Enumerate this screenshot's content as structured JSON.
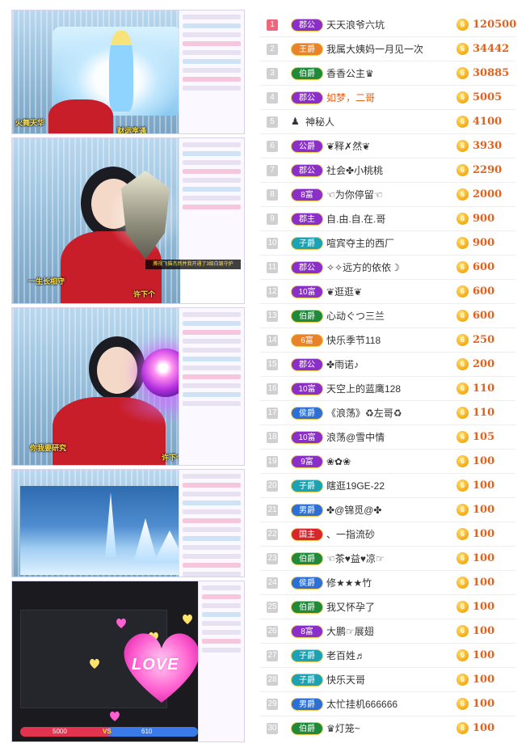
{
  "colors": {
    "rank_top": "#f0657a",
    "rank_default": "#d0d0d0",
    "amount": "#e6601a",
    "badge_purple": "#8b2fc9",
    "badge_orange": "#e8832b",
    "badge_green": "#1f8a3a",
    "badge_teal": "#1aa3b5",
    "badge_blue": "#2c6fd6",
    "badge_red": "#d8262d"
  },
  "screenshots": [
    {
      "caption": "",
      "overlay_text": "财运亨通",
      "left_label": "火舞天华"
    },
    {
      "caption": "",
      "overlay_left": "一生长相守",
      "overlay_right": "许下个",
      "banner": "腾视飞猫杰然并我开通了3级白银守护"
    },
    {
      "caption": "",
      "overlay_left": "你我要研究",
      "overlay_right": "许下个"
    },
    {
      "caption": ""
    },
    {
      "caption": "",
      "love": "LOVE",
      "vs_left": "5000",
      "vs_mid": "VS",
      "vs_right": "610"
    }
  ],
  "ranking": [
    {
      "rank": "1",
      "badge": "郡公",
      "badge_color": "#8b2fc9",
      "name": "天天浪爷六坑",
      "amount": "120500",
      "coin": "6"
    },
    {
      "rank": "2",
      "badge": "王爵",
      "badge_color": "#e8832b",
      "name": "我属大姨妈一月见一次",
      "amount": "34442",
      "coin": "6"
    },
    {
      "rank": "3",
      "badge": "伯爵",
      "badge_color": "#1f8a3a",
      "name": "香香公主♛",
      "amount": "30885",
      "coin": "6"
    },
    {
      "rank": "4",
      "badge": "郡公",
      "badge_color": "#8b2fc9",
      "name": "如梦，二哥",
      "amount": "5005",
      "coin": "6",
      "highlight": true
    },
    {
      "rank": "5",
      "badge": "",
      "badge_color": "",
      "name": "神秘人",
      "amount": "4100",
      "coin": "6",
      "mystery": true
    },
    {
      "rank": "6",
      "badge": "公爵",
      "badge_color": "#8b2fc9",
      "name": "❦释✗然❦",
      "amount": "3930",
      "coin": "6"
    },
    {
      "rank": "7",
      "badge": "郡公",
      "badge_color": "#8b2fc9",
      "name": "社会✤小桃桃",
      "amount": "2290",
      "coin": "6"
    },
    {
      "rank": "8",
      "badge": "8富",
      "badge_color": "#8b2fc9",
      "name": "☜为你停留☜",
      "amount": "2000",
      "coin": "6"
    },
    {
      "rank": "9",
      "badge": "郡主",
      "badge_color": "#8b2fc9",
      "name": "自.由.自.在.哥",
      "amount": "900",
      "coin": "6"
    },
    {
      "rank": "10",
      "badge": "子爵",
      "badge_color": "#1aa3b5",
      "name": "喧宾夺主的西厂",
      "amount": "900",
      "coin": "6"
    },
    {
      "rank": "11",
      "badge": "郡公",
      "badge_color": "#8b2fc9",
      "name": "✧✧远方的依依☽",
      "amount": "600",
      "coin": "6"
    },
    {
      "rank": "12",
      "badge": "10富",
      "badge_color": "#8b2fc9",
      "name": "❦逛逛❦",
      "amount": "600",
      "coin": "6"
    },
    {
      "rank": "13",
      "badge": "伯爵",
      "badge_color": "#1f8a3a",
      "name": "心动ぐつ三兰",
      "amount": "600",
      "coin": "6"
    },
    {
      "rank": "14",
      "badge": "6富",
      "badge_color": "#e8832b",
      "name": "快乐季节118",
      "amount": "250",
      "coin": "6"
    },
    {
      "rank": "15",
      "badge": "郡公",
      "badge_color": "#8b2fc9",
      "name": "✤雨诺♪",
      "amount": "200",
      "coin": "6"
    },
    {
      "rank": "16",
      "badge": "10富",
      "badge_color": "#8b2fc9",
      "name": "天空上的蓝鹰128",
      "amount": "110",
      "coin": "6"
    },
    {
      "rank": "17",
      "badge": "侯爵",
      "badge_color": "#2c6fd6",
      "name": "《浪荡》♻左哥♻",
      "amount": "110",
      "coin": "6"
    },
    {
      "rank": "18",
      "badge": "10富",
      "badge_color": "#8b2fc9",
      "name": "浪荡@雪中情",
      "amount": "105",
      "coin": "6"
    },
    {
      "rank": "19",
      "badge": "9富",
      "badge_color": "#8b2fc9",
      "name": "❀✿❀",
      "amount": "100",
      "coin": "6"
    },
    {
      "rank": "20",
      "badge": "子爵",
      "badge_color": "#1aa3b5",
      "name": "瞎逛19GE-22",
      "amount": "100",
      "coin": "6"
    },
    {
      "rank": "21",
      "badge": "男爵",
      "badge_color": "#2c6fd6",
      "name": "✤@锦觅@✤",
      "amount": "100",
      "coin": "6"
    },
    {
      "rank": "22",
      "badge": "国主",
      "badge_color": "#d8262d",
      "name": "、一指流砂",
      "amount": "100",
      "coin": "6"
    },
    {
      "rank": "23",
      "badge": "伯爵",
      "badge_color": "#1f8a3a",
      "name": "☜茶♥益♥凉☞",
      "amount": "100",
      "coin": "6"
    },
    {
      "rank": "24",
      "badge": "侯爵",
      "badge_color": "#2c6fd6",
      "name": "修★★★竹",
      "amount": "100",
      "coin": "6"
    },
    {
      "rank": "25",
      "badge": "伯爵",
      "badge_color": "#1f8a3a",
      "name": "我又怀孕了",
      "amount": "100",
      "coin": "6"
    },
    {
      "rank": "26",
      "badge": "8富",
      "badge_color": "#8b2fc9",
      "name": "大鹏☞展翅",
      "amount": "100",
      "coin": "6"
    },
    {
      "rank": "27",
      "badge": "子爵",
      "badge_color": "#1aa3b5",
      "name": "老百姓♬",
      "amount": "100",
      "coin": "6"
    },
    {
      "rank": "28",
      "badge": "子爵",
      "badge_color": "#1aa3b5",
      "name": "快乐天哥",
      "amount": "100",
      "coin": "6"
    },
    {
      "rank": "29",
      "badge": "男爵",
      "badge_color": "#2c6fd6",
      "name": "太忙挂机666666",
      "amount": "100",
      "coin": "6"
    },
    {
      "rank": "30",
      "badge": "伯爵",
      "badge_color": "#1f8a3a",
      "name": "♛灯笼~",
      "amount": "100",
      "coin": "6"
    }
  ]
}
